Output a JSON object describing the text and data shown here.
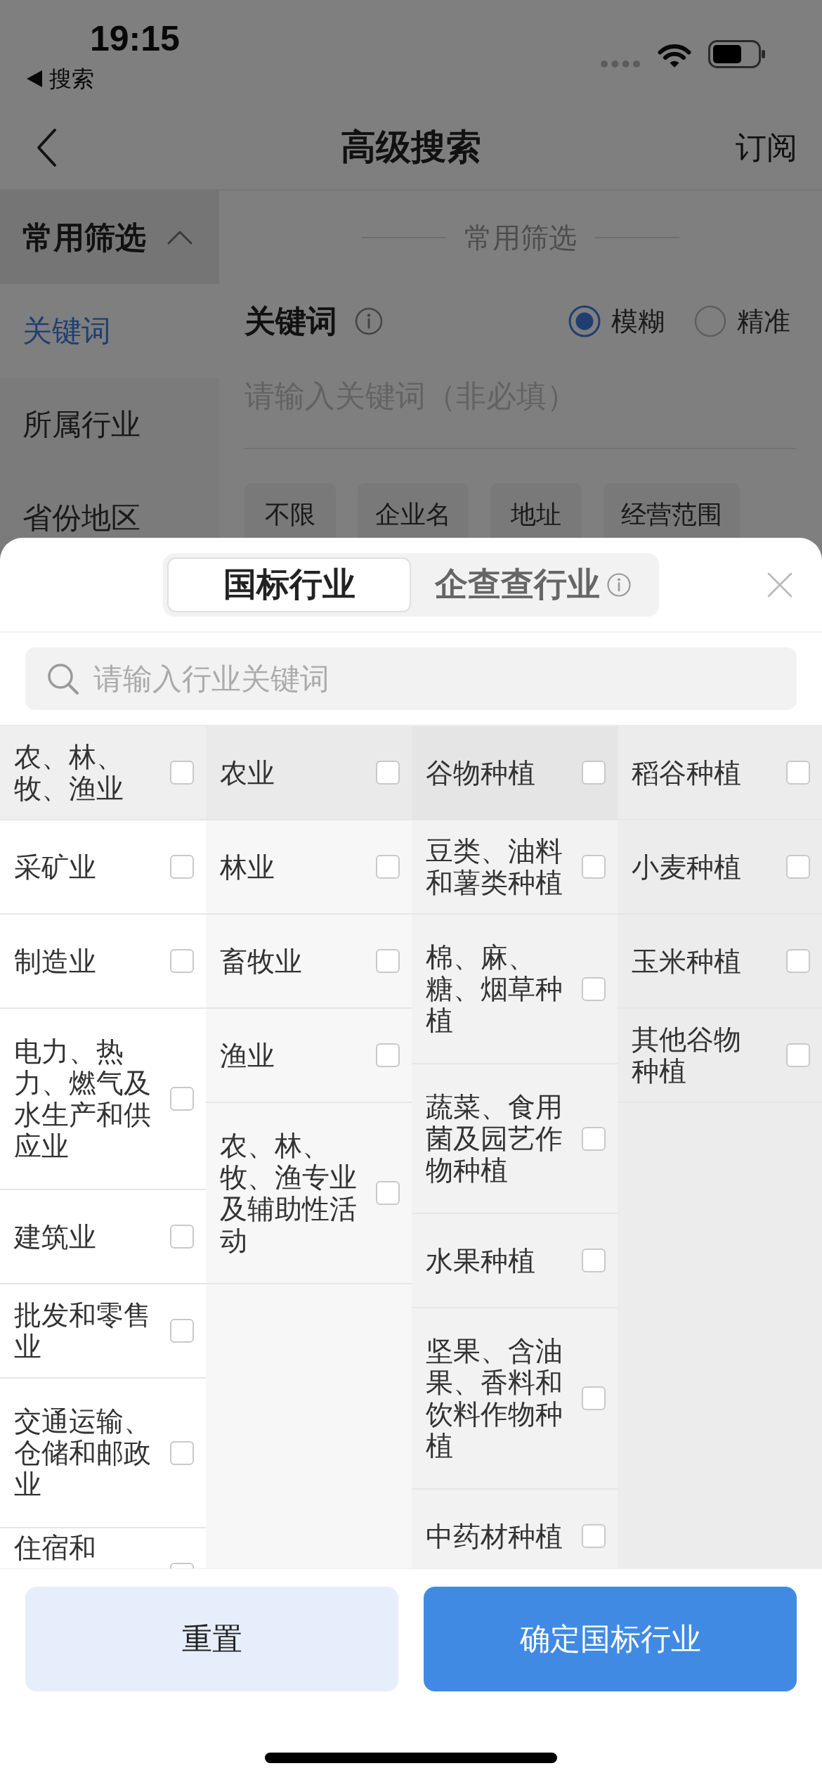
{
  "status_bar": {
    "time": "19:15",
    "back_label": "搜索"
  },
  "nav_bar": {
    "title": "高级搜索",
    "action": "订阅"
  },
  "sidebar": {
    "group": {
      "label": "常用筛选",
      "expanded": true
    },
    "items": [
      {
        "label": "关键词",
        "selected": true
      },
      {
        "label": "所属行业",
        "selected": false
      },
      {
        "label": "省份地区",
        "selected": false
      }
    ]
  },
  "filter_panel": {
    "section_title": "常用筛选",
    "keyword": {
      "label": "关键词",
      "modes": [
        {
          "label": "模糊",
          "selected": true
        },
        {
          "label": "精准",
          "selected": false
        }
      ],
      "placeholder": "请输入关键词（非必填）"
    },
    "scopes": [
      "不限",
      "企业名",
      "地址",
      "经营范围"
    ]
  },
  "sheet": {
    "tabs": [
      {
        "label": "国标行业",
        "selected": true,
        "info": false
      },
      {
        "label": "企查查行业",
        "selected": false,
        "info": true
      }
    ],
    "search": {
      "placeholder": "请输入行业关键词"
    },
    "columns": [
      {
        "items": [
          {
            "label": "农、林、牧、渔业",
            "selected": true,
            "checked": false
          },
          {
            "label": "采矿业",
            "selected": false,
            "checked": false
          },
          {
            "label": "制造业",
            "selected": false,
            "checked": false
          },
          {
            "label": "电力、热力、燃气及水生产和供应业",
            "selected": false,
            "checked": false
          },
          {
            "label": "建筑业",
            "selected": false,
            "checked": false
          },
          {
            "label": "批发和零售业",
            "selected": false,
            "checked": false
          },
          {
            "label": "交通运输、仓储和邮政业",
            "selected": false,
            "checked": false
          },
          {
            "label": "住宿和",
            "selected": false,
            "checked": false,
            "cut_off": true
          }
        ]
      },
      {
        "items": [
          {
            "label": "农业",
            "selected": true,
            "checked": false
          },
          {
            "label": "林业",
            "selected": false,
            "checked": false
          },
          {
            "label": "畜牧业",
            "selected": false,
            "checked": false
          },
          {
            "label": "渔业",
            "selected": false,
            "checked": false
          },
          {
            "label": "农、林、牧、渔专业及辅助性活动",
            "selected": false,
            "checked": false
          }
        ]
      },
      {
        "items": [
          {
            "label": "谷物种植",
            "selected": true,
            "checked": false
          },
          {
            "label": "豆类、油料和薯类种植",
            "selected": false,
            "checked": false
          },
          {
            "label": "棉、麻、糖、烟草种植",
            "selected": false,
            "checked": false
          },
          {
            "label": "蔬菜、食用菌及园艺作物种植",
            "selected": false,
            "checked": false
          },
          {
            "label": "水果种植",
            "selected": false,
            "checked": false
          },
          {
            "label": "坚果、含油果、香料和饮料作物种植",
            "selected": false,
            "checked": false
          },
          {
            "label": "中药材种植",
            "selected": false,
            "checked": false
          }
        ]
      },
      {
        "items": [
          {
            "label": "稻谷种植",
            "selected": false,
            "checked": false
          },
          {
            "label": "小麦种植",
            "selected": false,
            "checked": false
          },
          {
            "label": "玉米种植",
            "selected": false,
            "checked": false
          },
          {
            "label": "其他谷物种植",
            "selected": false,
            "checked": false
          }
        ]
      }
    ],
    "buttons": [
      {
        "label": "重置",
        "kind": "secondary"
      },
      {
        "label": "确定国标行业",
        "kind": "primary"
      }
    ]
  }
}
